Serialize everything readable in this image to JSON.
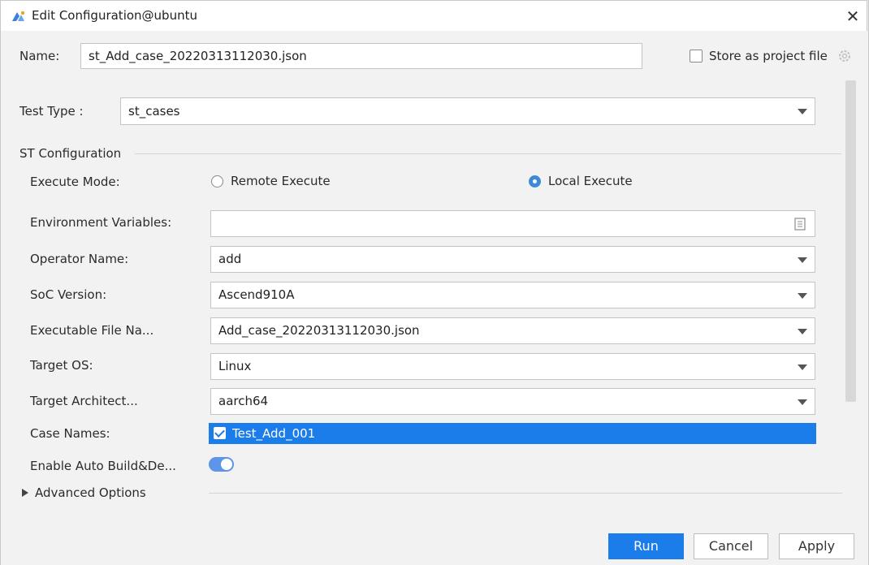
{
  "window": {
    "title": "Edit Configuration@ubuntu",
    "app_icon": "app-logo-icon",
    "close_glyph": "✕"
  },
  "name_row": {
    "label": "Name:",
    "value": "st_Add_case_20220313112030.json",
    "store_label": "Store as project file",
    "store_checked": false
  },
  "test_type": {
    "label": "Test Type :",
    "value": "st_cases"
  },
  "st_config": {
    "section_title": "ST Configuration",
    "execute_mode": {
      "label": "Execute Mode:",
      "options": [
        "Remote Execute",
        "Local Execute"
      ],
      "selected": "Local Execute"
    },
    "env_vars": {
      "label": "Environment Variables:",
      "value": ""
    },
    "operator_name": {
      "label": "Operator Name:",
      "value": "add"
    },
    "soc_version": {
      "label": "SoC Version:",
      "value": "Ascend910A"
    },
    "executable_file": {
      "label": "Executable File Na...",
      "value": "Add_case_20220313112030.json"
    },
    "target_os": {
      "label": "Target OS:",
      "value": "Linux"
    },
    "target_arch": {
      "label": "Target Architect...",
      "value": "aarch64"
    },
    "case_names": {
      "label": "Case Names:",
      "items": [
        {
          "name": "Test_Add_001",
          "checked": true
        }
      ]
    },
    "auto_build": {
      "label": "Enable Auto Build&De...",
      "enabled": true
    }
  },
  "advanced": {
    "label": "Advanced Options",
    "expanded": false
  },
  "buttons": {
    "run": "Run",
    "cancel": "Cancel",
    "apply": "Apply"
  },
  "colors": {
    "accent": "#1a7de9",
    "toggle": "#5d95e8",
    "background": "#f2f2f2"
  }
}
